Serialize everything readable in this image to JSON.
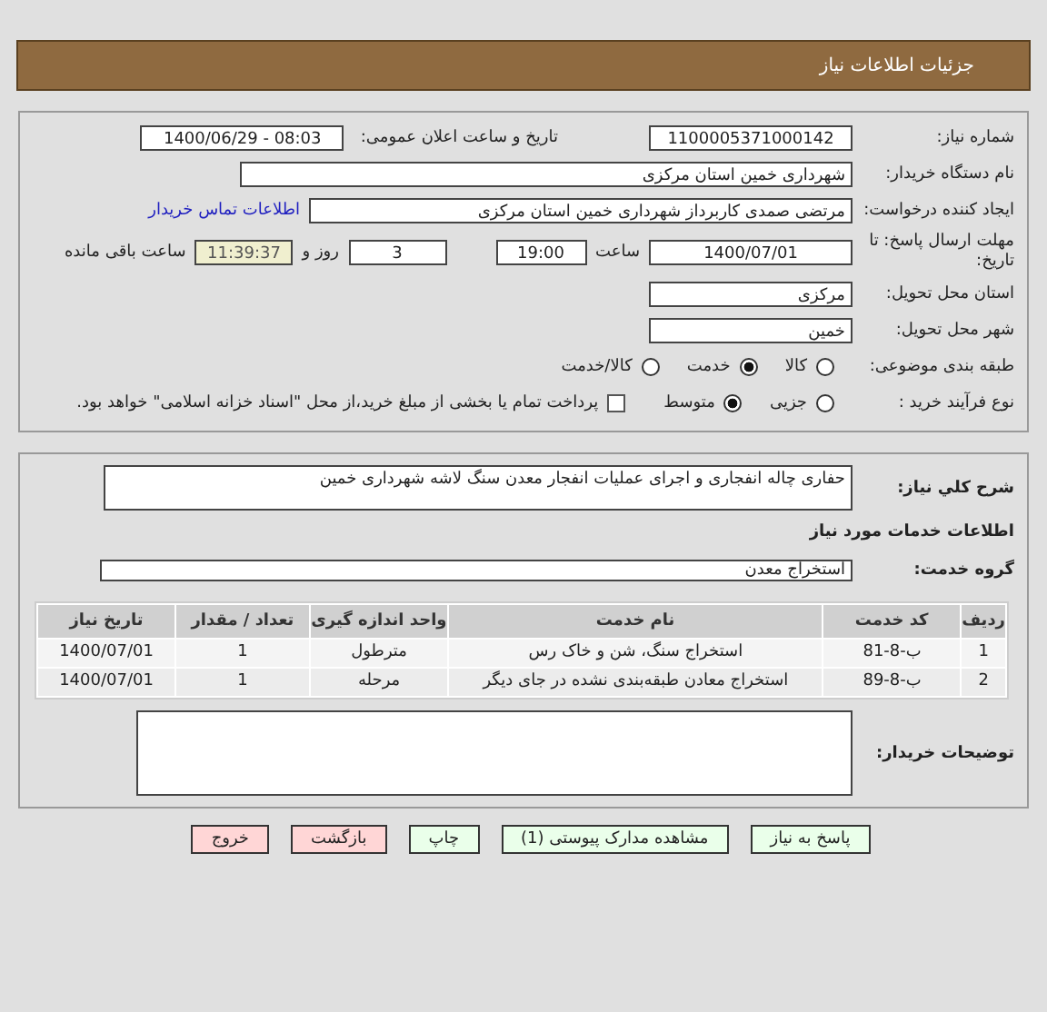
{
  "header": {
    "title": "جزئیات اطلاعات نیاز"
  },
  "info": {
    "need_number": {
      "label": "شماره نیاز:",
      "value": "1100005371000142"
    },
    "announce": {
      "label": "تاریخ و ساعت اعلان عمومی:",
      "value": "1400/06/29 - 08:03"
    },
    "buyer": {
      "label": "نام دستگاه خریدار:",
      "value": "شهرداری خمین استان مرکزی"
    },
    "requester": {
      "label": "ایجاد کننده درخواست:",
      "value": "مرتضی صمدی کاربرداز شهرداری خمین استان مرکزی",
      "link": "اطلاعات تماس خریدار"
    },
    "deadline": {
      "label": "مهلت ارسال پاسخ: تا تاریخ:",
      "date": "1400/07/01",
      "time_label": "ساعت",
      "time": "19:00",
      "days": "3",
      "days_label": "روز و",
      "remaining": "11:39:37",
      "remaining_label": "ساعت باقی مانده"
    },
    "province": {
      "label": "استان محل تحویل:",
      "value": "مرکزی"
    },
    "city": {
      "label": "شهر محل تحویل:",
      "value": "خمین"
    },
    "category": {
      "label": "طبقه بندی موضوعی:",
      "options": [
        {
          "label": "کالا",
          "selected": false
        },
        {
          "label": "خدمت",
          "selected": true
        },
        {
          "label": "کالا/خدمت",
          "selected": false
        }
      ]
    },
    "process": {
      "label": "نوع فرآیند خرید :",
      "options": [
        {
          "label": "جزیی",
          "selected": false
        },
        {
          "label": "متوسط",
          "selected": true
        }
      ],
      "payment": {
        "label": "پرداخت تمام یا بخشی از مبلغ خرید،از محل \"اسناد خزانه اسلامی\" خواهد بود.",
        "checked": false
      }
    }
  },
  "details": {
    "description": {
      "label": "شرح کلي نياز:",
      "value": "حفاری چاله انفجاری و اجرای عملیات انفجار معدن سنگ لاشه شهرداری خمین"
    },
    "services_heading": "اطلاعات خدمات مورد نیاز",
    "group": {
      "label": "گروه خدمت:",
      "value": "استخراج معدن"
    },
    "table": {
      "columns": [
        "ردیف",
        "کد خدمت",
        "نام خدمت",
        "واحد اندازه گیری",
        "تعداد / مقدار",
        "تاریخ نیاز"
      ],
      "rows": [
        [
          "1",
          "ب-8-81",
          "استخراج سنگ، شن و خاک رس",
          "مترطول",
          "1",
          "1400/07/01"
        ],
        [
          "2",
          "ب-8-89",
          "استخراج معادن طبقه‌بندی نشده در جای دیگر",
          "مرحله",
          "1",
          "1400/07/01"
        ]
      ]
    },
    "remarks": {
      "label": "توضیحات خریدار:"
    }
  },
  "buttons": [
    {
      "label": "پاسخ به نیاز",
      "kind": "normal"
    },
    {
      "label": "مشاهده مدارک پیوستی (1)",
      "kind": "normal"
    },
    {
      "label": "چاپ",
      "kind": "normal"
    },
    {
      "label": "بازگشت",
      "kind": "exit"
    },
    {
      "label": "خروج",
      "kind": "exit"
    }
  ]
}
